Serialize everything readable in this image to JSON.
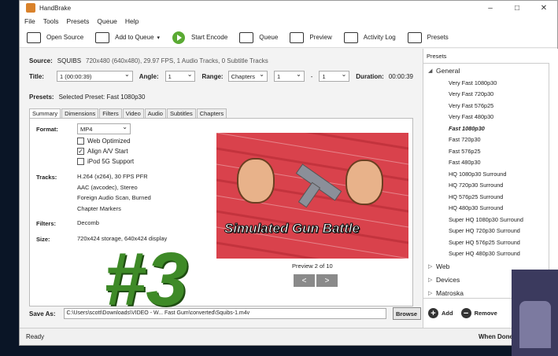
{
  "window": {
    "title": "HandBrake"
  },
  "menu": [
    "File",
    "Tools",
    "Presets",
    "Queue",
    "Help"
  ],
  "toolbar": {
    "open_source": "Open Source",
    "add_to_queue": "Add to Queue",
    "start_encode": "Start Encode",
    "queue": "Queue",
    "preview": "Preview",
    "activity_log": "Activity Log",
    "presets": "Presets"
  },
  "source": {
    "label": "Source:",
    "name": "SQUIBS",
    "info": "720x480 (640x480), 29.97 FPS, 1 Audio Tracks, 0 Subtitle Tracks"
  },
  "title_row": {
    "title_label": "Title:",
    "title_value": "1 (00:00:39)",
    "angle_label": "Angle:",
    "angle_value": "1",
    "range_label": "Range:",
    "range_mode": "Chapters",
    "range_start": "1",
    "range_dash": "-",
    "range_end": "1",
    "duration_label": "Duration:",
    "duration_value": "00:00:39"
  },
  "presets_row": {
    "label": "Presets:",
    "value": "Selected Preset: Fast 1080p30"
  },
  "tabs": [
    "Summary",
    "Dimensions",
    "Filters",
    "Video",
    "Audio",
    "Subtitles",
    "Chapters"
  ],
  "summary": {
    "format_label": "Format:",
    "format_value": "MP4",
    "web_optimized": "Web Optimized",
    "align_av": "Align A/V Start",
    "ipod": "iPod 5G Support",
    "tracks_label": "Tracks:",
    "tracks": [
      "H.264 (x264), 30 FPS PFR",
      "AAC (avcodec), Stereo",
      "Foreign Audio Scan, Burned",
      "Chapter Markers"
    ],
    "filters_label": "Filters:",
    "filters_value": "Decomb",
    "size_label": "Size:",
    "size_value": "720x424 storage, 640x424 display",
    "preview_caption": "Simulated Gun Battle",
    "preview_label": "Preview 2 of 10"
  },
  "save_as": {
    "label": "Save As:",
    "path": "C:\\Users\\scott\\Downloads\\VIDEO - W... Fast Gum\\converted\\Squibs-1.m4v",
    "browse": "Browse"
  },
  "preset_panel": {
    "header": "Presets",
    "groups": [
      {
        "name": "General",
        "expanded": true,
        "items": [
          "Very Fast 1080p30",
          "Very Fast 720p30",
          "Very Fast 576p25",
          "Very Fast 480p30",
          "Fast 1080p30",
          "Fast 720p30",
          "Fast 576p25",
          "Fast 480p30",
          "HQ 1080p30 Surround",
          "HQ 720p30 Surround",
          "HQ 576p25 Surround",
          "HQ 480p30 Surround",
          "Super HQ 1080p30 Surround",
          "Super HQ 720p30 Surround",
          "Super HQ 576p25 Surround",
          "Super HQ 480p30 Surround"
        ],
        "selected": "Fast 1080p30"
      },
      {
        "name": "Web",
        "expanded": false
      },
      {
        "name": "Devices",
        "expanded": false
      },
      {
        "name": "Matroska",
        "expanded": false
      }
    ],
    "add": "Add",
    "remove": "Remove"
  },
  "status": {
    "left": "Ready",
    "right": "When Done"
  },
  "overlay_text": "#3",
  "colors": {
    "accent_green": "#3e8a27",
    "play_green": "#5aaa33",
    "preview_bg": "#d9424c"
  }
}
